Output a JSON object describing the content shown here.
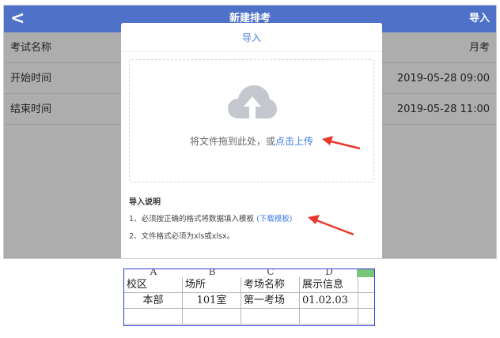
{
  "header": {
    "back_icon": "chevron-left-icon",
    "back_glyph": "<",
    "title": "新建排考",
    "action": "导入"
  },
  "form": [
    {
      "label": "考试名称",
      "value": "月考"
    },
    {
      "label": "开始时间",
      "value": "2019-05-28 09:00"
    },
    {
      "label": "结束时间",
      "value": "2019-05-28 11:00"
    }
  ],
  "modal": {
    "title": "导入",
    "upload_icon": "cloud-upload-icon",
    "upload_text": "将文件拖到此处，或",
    "upload_link": "点击上传",
    "notes_title": "导入说明",
    "note1_text": "1、必须按正确的格式将数据填入模板",
    "note1_link": "(下载模板)",
    "note2_text": "2、文件格式必须为xls或xlsx。"
  },
  "colors": {
    "header": "#4f72c8",
    "link": "#3d7be8",
    "arrow": "#e8382d"
  },
  "sheet": {
    "columns": [
      "A",
      "B",
      "C",
      "D"
    ],
    "rows": [
      [
        "校区",
        "场所",
        "考场名称",
        "展示信息"
      ],
      [
        "本部",
        "101室",
        "第一考场",
        "01.02.03"
      ]
    ]
  }
}
